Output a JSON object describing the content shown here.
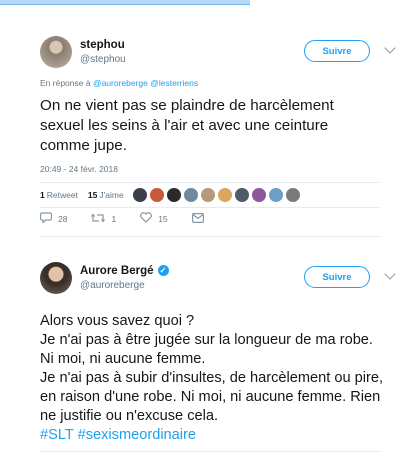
{
  "tweet1": {
    "name": "stephou",
    "handle": "@stephou",
    "follow_label": "Suivre",
    "reply_prefix": "En réponse à",
    "reply_mentions": "@auroreberge @lesterriens",
    "text": "On ne vient pas se plaindre de harcèlement sexuel les seins à l'air et avec une ceinture comme jupe.",
    "timestamp": "20:49 - 24 févr. 2018",
    "retweets_count": "1",
    "retweets_label": "Retweet",
    "likes_count": "15",
    "likes_label": "J'aime",
    "reply_count": "28",
    "retweet_action_count": "1",
    "like_action_count": "15",
    "liker_colors": [
      "#3a3f4a",
      "#c65a3a",
      "#2a2a2a",
      "#6f8a9e",
      "#b39a7a",
      "#d9a65c",
      "#4f5b6a",
      "#8a5a9a",
      "#6aa0c8",
      "#7a7a7a"
    ]
  },
  "tweet2": {
    "name": "Aurore Bergé",
    "handle": "@auroreberge",
    "follow_label": "Suivre",
    "text": "Alors vous savez quoi ?\nJe n'ai pas à être jugée sur la longueur de ma robe. Ni moi, ni aucune femme.\nJe n'ai pas à subir d'insultes, de harcèlement ou pire, en raison d'une robe. Ni moi, ni aucune femme. Rien ne justifie ou n'excuse cela.",
    "hashtags": "#SLT #sexismeordinaire"
  },
  "icons": {
    "reply": "reply-icon",
    "retweet": "retweet-icon",
    "like": "heart-icon",
    "message": "envelope-icon",
    "verified": "verified-badge-icon",
    "more": "chevron-down-icon"
  },
  "colors": {
    "accent": "#1da1f2",
    "muted": "#657786"
  }
}
